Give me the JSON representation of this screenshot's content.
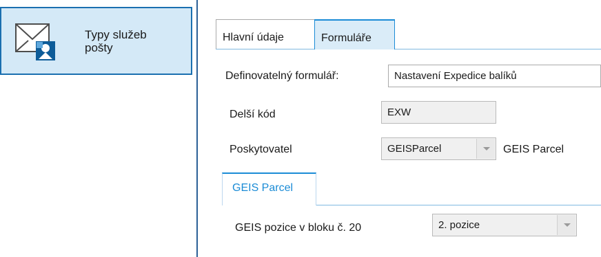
{
  "nav": {
    "item_label": "Typy služeb\npošty",
    "icon": "mail-service-icon"
  },
  "tabs": [
    {
      "label": "Hlavní údaje",
      "active": false
    },
    {
      "label": "Formuláře",
      "active": true
    }
  ],
  "form": {
    "definable_form_label": "Definovatelný formulář:",
    "definable_form_value": "Nastavení Expedice balíků",
    "longer_code_label": "Delší kód",
    "longer_code_value": "EXW",
    "provider_label": "Poskytovatel",
    "provider_value": "GEISParcel",
    "provider_name": "GEIS Parcel"
  },
  "subtab": {
    "label": "GEIS Parcel"
  },
  "geis": {
    "position_label": "GEIS pozice v bloku č. 20",
    "position_value": "2. pozice"
  },
  "colors": {
    "accent": "#1a8bd6",
    "selected_bg": "#d4e9f7",
    "tab_active_bg": "#daecf8"
  }
}
